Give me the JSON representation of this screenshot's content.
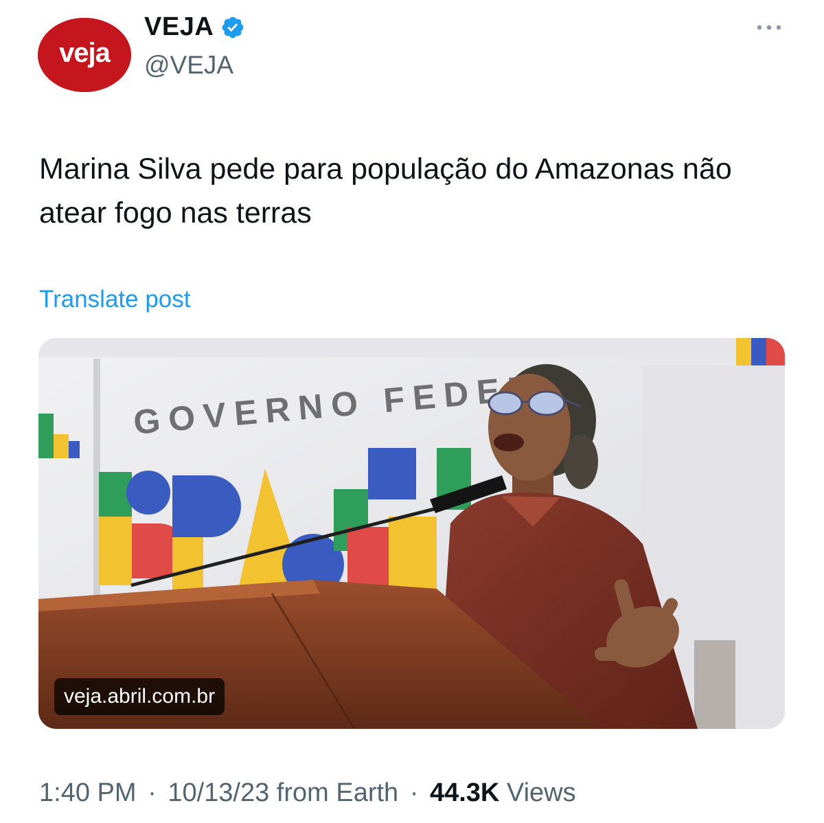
{
  "author": {
    "display_name": "VEJA",
    "handle": "@VEJA",
    "avatar_text": "veja",
    "verified": true
  },
  "post": {
    "text": "Marina Silva pede para população do Amazonas não atear fogo nas terras",
    "translate_label": "Translate post"
  },
  "media": {
    "domain": "veja.abril.com.br",
    "backdrop_text": "GOVERNO FEDER"
  },
  "meta": {
    "time": "1:40 PM",
    "separator": "·",
    "date_location": "10/13/23 from Earth",
    "views_count": "44.3K",
    "views_label": "Views"
  },
  "colors": {
    "link": "#1d9bf0",
    "verified": "#1d9bf0",
    "avatar_bg": "#c4161c",
    "secondary_text": "#536471"
  }
}
